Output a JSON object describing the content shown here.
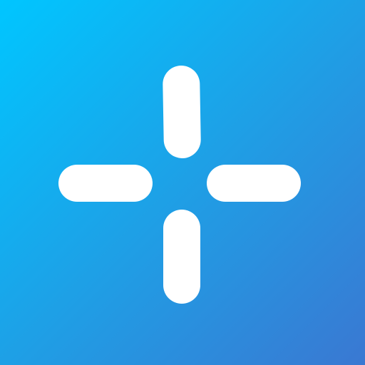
{
  "icon": {
    "name": "crosshair-plus-icon",
    "background_gradient": [
      "#00c6ff",
      "#1ea0e6",
      "#3a78d2"
    ],
    "foreground_color": "#ffffff"
  }
}
